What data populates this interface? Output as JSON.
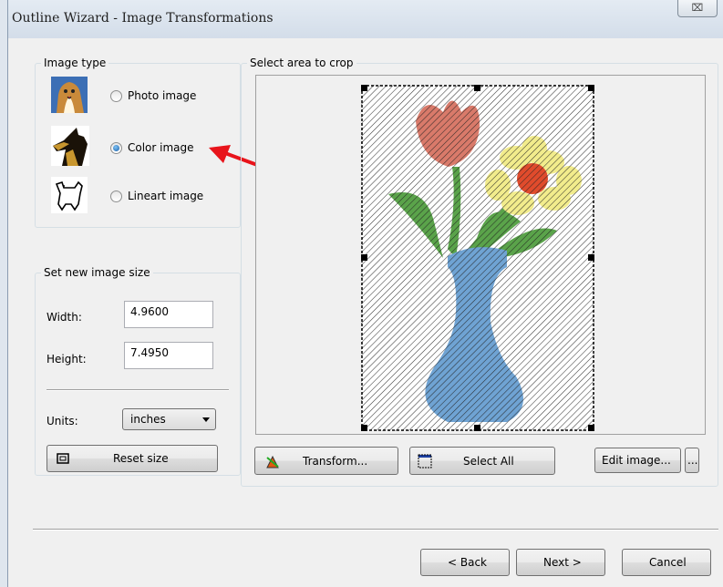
{
  "window": {
    "title": "Outline Wizard - Image Transformations",
    "close_glyph": "⌧"
  },
  "image_type": {
    "legend": "Image type",
    "options": [
      {
        "label": "Photo image",
        "selected": false,
        "icon": "collie-photo-icon"
      },
      {
        "label": "Color image",
        "selected": true,
        "icon": "dog-color-icon"
      },
      {
        "label": "Lineart image",
        "selected": false,
        "icon": "dog-lineart-icon"
      }
    ]
  },
  "image_size": {
    "legend": "Set new image size",
    "width_label": "Width:",
    "width_value": "4.9600",
    "height_label": "Height:",
    "height_value": "7.4950",
    "units_label": "Units:",
    "units_value": "inches",
    "reset_label": "Reset size"
  },
  "crop": {
    "legend": "Select area to crop",
    "transform_label": "Transform...",
    "select_all_label": "Select All",
    "edit_image_label": "Edit image...",
    "more_label": "..."
  },
  "footer": {
    "back_label": "< Back",
    "next_label": "Next >",
    "cancel_label": "Cancel"
  },
  "colors": {
    "annotation_arrow": "#e8141b",
    "vase": "#6fa3d3",
    "tulip": "#d97a6a",
    "daisy": "#f2ec8c",
    "daisy_center": "#e04b2c",
    "leaves": "#5aa34a"
  }
}
